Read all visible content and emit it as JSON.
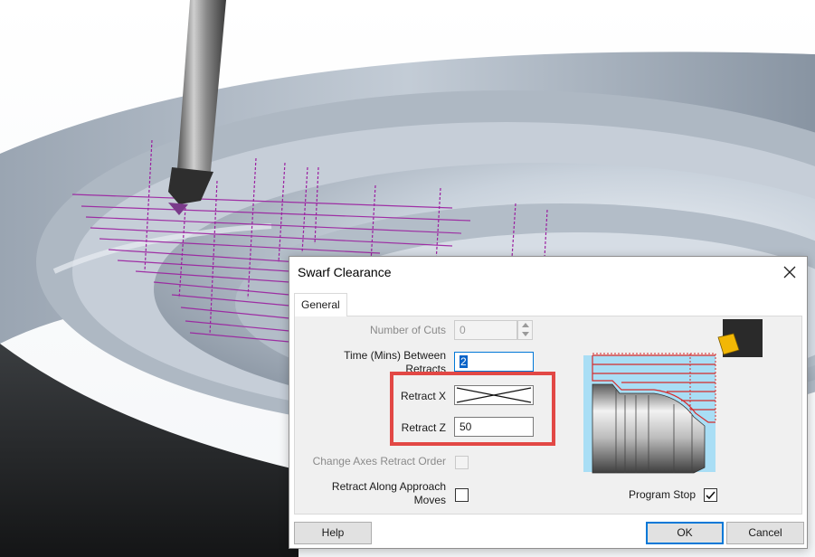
{
  "dialog": {
    "title": "Swarf Clearance",
    "tabs": [
      {
        "label": "General"
      }
    ],
    "fields": {
      "number_of_cuts": {
        "label": "Number of Cuts",
        "value": "0",
        "enabled": false
      },
      "time_between_retracts": {
        "label": "Time (Mins) Between Retracts",
        "value": "2"
      },
      "retract_x": {
        "label": "Retract X",
        "value": ""
      },
      "retract_z": {
        "label": "Retract Z",
        "value": "50"
      },
      "change_axes_retract_order": {
        "label": "Change Axes Retract Order",
        "checked": false,
        "enabled": false
      },
      "retract_along_approach_moves": {
        "label": "Retract Along Approach Moves",
        "checked": false
      },
      "program_stop": {
        "label": "Program Stop",
        "checked": true
      }
    },
    "buttons": {
      "help": "Help",
      "ok": "OK",
      "cancel": "Cancel"
    }
  },
  "colors": {
    "highlight": "#e24845",
    "toolpath": "#9b1fa0",
    "diagram_stock": "#a9def5",
    "diagram_path": "#d52b2b",
    "insert": "#f2b705",
    "accent": "#0078d7"
  }
}
